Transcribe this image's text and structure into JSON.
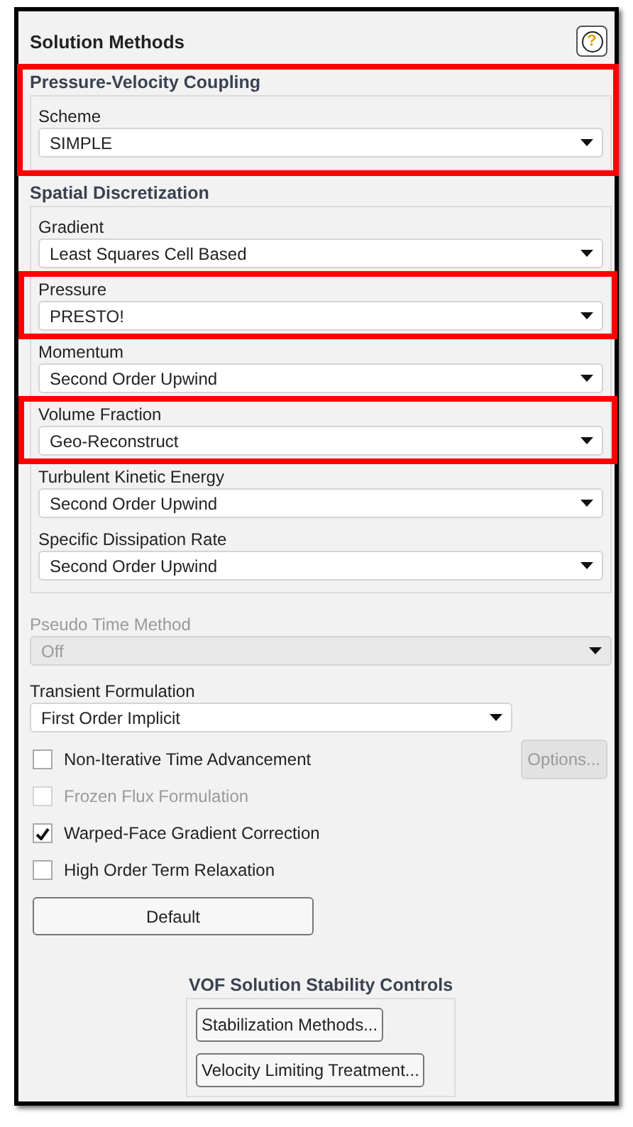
{
  "panel": {
    "title": "Solution Methods",
    "help": "?"
  },
  "sections": [
    {
      "title": "Pressure-Velocity Coupling",
      "highlighted": true,
      "fields": [
        {
          "label": "Scheme",
          "value": "SIMPLE",
          "highlighted": false
        }
      ]
    },
    {
      "title": "Spatial Discretization",
      "highlighted": false,
      "fields": [
        {
          "label": "Gradient",
          "value": "Least Squares Cell Based",
          "highlighted": false
        },
        {
          "label": "Pressure",
          "value": "PRESTO!",
          "highlighted": true
        },
        {
          "label": "Momentum",
          "value": "Second Order Upwind",
          "highlighted": false
        },
        {
          "label": "Volume Fraction",
          "value": "Geo-Reconstruct",
          "highlighted": true
        },
        {
          "label": "Turbulent Kinetic Energy",
          "value": "Second Order Upwind",
          "highlighted": false
        },
        {
          "label": "Specific Dissipation Rate",
          "value": "Second Order Upwind",
          "highlighted": false
        }
      ]
    }
  ],
  "pseudo_time": {
    "label": "Pseudo Time Method",
    "value": "Off",
    "disabled": true
  },
  "transient": {
    "label": "Transient Formulation",
    "value": "First Order Implicit",
    "disabled": false
  },
  "checkboxes": [
    {
      "label": "Non-Iterative Time Advancement",
      "checked": false,
      "disabled": false,
      "button": {
        "label": "Options...",
        "disabled": true
      }
    },
    {
      "label": "Frozen Flux Formulation",
      "checked": false,
      "disabled": true
    },
    {
      "label": "Warped-Face Gradient Correction",
      "checked": true,
      "disabled": false
    },
    {
      "label": "High Order Term Relaxation",
      "checked": false,
      "disabled": false
    }
  ],
  "default_button": "Default",
  "vof": {
    "title": "VOF Solution Stability Controls",
    "buttons": [
      "Stabilization Methods...",
      "Velocity Limiting Treatment..."
    ]
  }
}
